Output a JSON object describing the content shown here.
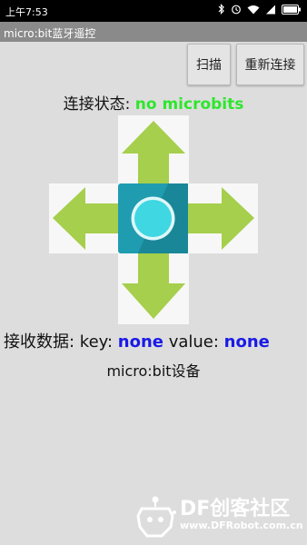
{
  "status_bar": {
    "time": "上午7:53"
  },
  "title_bar": {
    "title": "micro:bit蓝牙遥控"
  },
  "toolbar": {
    "scan_label": "扫描",
    "reconnect_label": "重新连接"
  },
  "connection": {
    "label": "连接状态: ",
    "value": "no microbits"
  },
  "received": {
    "label": "接收数据: key: ",
    "key": "none",
    "value_label": " value: ",
    "value": "none"
  },
  "device": {
    "label": "micro:bit设备"
  },
  "watermark": {
    "brand": "DF创客社区",
    "url": "www.DFRobot.com.cn"
  },
  "colors": {
    "arrow": "#a5cf4c",
    "center": "#1f9cb0",
    "center_ring": "#3fd7e2",
    "connection_value": "#2ee62e",
    "received_value": "#1a1ae6"
  },
  "icons": [
    "bluetooth-icon",
    "alarm-icon",
    "wifi-icon",
    "signal-icon",
    "battery-icon",
    "arrow-up-icon",
    "arrow-down-icon",
    "arrow-left-icon",
    "arrow-right-icon",
    "center-button-icon",
    "robot-logo-icon"
  ]
}
